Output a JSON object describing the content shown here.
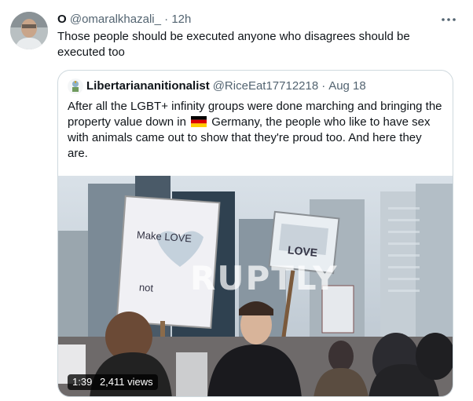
{
  "tweet": {
    "display_name": "O",
    "handle": "@omaralkhazali_",
    "separator": "·",
    "time": "12h",
    "text": "Those people should be executed anyone who disagrees should be executed too",
    "more_icon": "more-horizontal-icon"
  },
  "quoted_tweet": {
    "display_name": "Libertariananitionalist",
    "handle": "@RiceEat17712218",
    "separator": "·",
    "date": "Aug 18",
    "text_before_flag": "After all the LGBT+ infinity groups were done marching and bringing the property value down in",
    "flag_icon": "germany-flag-icon",
    "text_after_flag": "Germany, the people who like to have sex with animals came out to show that they're proud too.  And here they are.",
    "media": {
      "duration": "1:39",
      "views": "2,411 views",
      "watermark": "RUPTLY",
      "sign_left_line1": "Make LOVE",
      "sign_left_line2": "not",
      "sign_right": "LOVE"
    }
  }
}
